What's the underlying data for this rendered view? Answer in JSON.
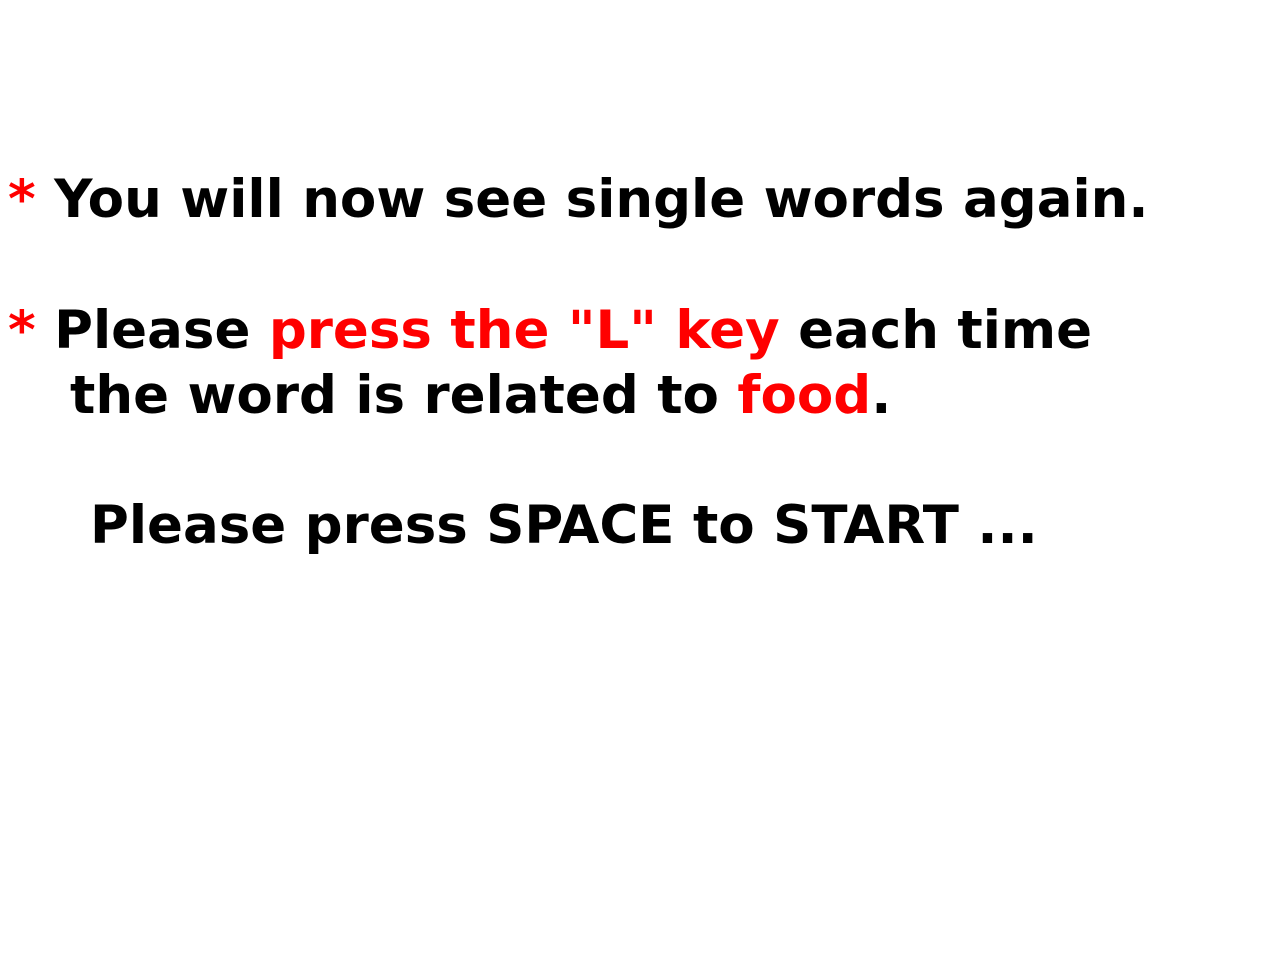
{
  "colors": {
    "background": "#ffffff",
    "text": "#000000",
    "highlight": "#ff0000"
  },
  "instructions": {
    "line1": {
      "bullet": "*",
      "text": " You will now see single words again."
    },
    "line2": {
      "bullet": "*",
      "before": " Please ",
      "highlight": "press the \"L\" key",
      "after": " each time"
    },
    "line3": {
      "before": "the word is related to ",
      "highlight": "food",
      "after": "."
    },
    "start_prompt": "Please press SPACE to START ..."
  }
}
